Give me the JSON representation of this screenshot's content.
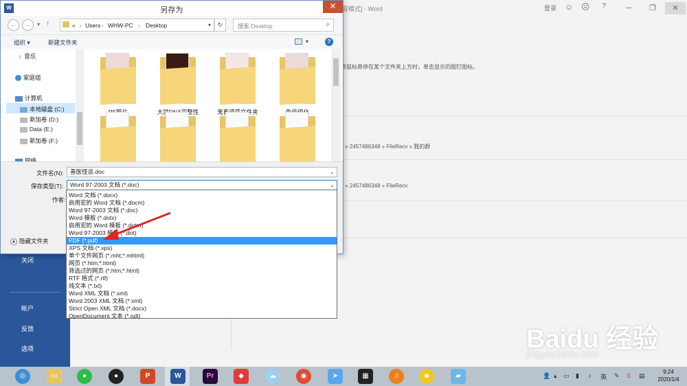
{
  "word": {
    "title_partial": "容模式] - Word",
    "login": "登录",
    "hint_text": "将鼠标悬停在某个文件夹上方时，单击显示的图钉图标。",
    "path1": "s » 2457486348 » FileRecv » 我的群",
    "path2": "s » 2457486348 » FileRecv",
    "nav": {
      "close": "关闭",
      "account": "帐户",
      "feedback": "反馈",
      "options": "选项"
    }
  },
  "dialog": {
    "title": "另存为",
    "app_icon": "W",
    "breadcrumb": [
      "«",
      "Users",
      "WHW-PC",
      "Desktop"
    ],
    "search_placeholder": "搜索 Desktop",
    "toolbar": {
      "organize": "组织 ▾",
      "new_folder": "新建文件夹"
    },
    "tree": [
      {
        "label": "音乐",
        "icon": "music-icon"
      },
      {
        "label": "家庭组",
        "icon": "homegroup-icon"
      },
      {
        "label": "计算机",
        "icon": "computer-icon"
      },
      {
        "label": "本地磁盘 (C:)",
        "icon": "drive-icon"
      },
      {
        "label": "新加卷 (D:)",
        "icon": "drive-icon"
      },
      {
        "label": "Data (E:)",
        "icon": "drive-icon"
      },
      {
        "label": "新加卷 (F:)",
        "icon": "drive-icon"
      },
      {
        "label": "网络",
        "icon": "network-icon"
      }
    ],
    "folders": [
      "PS照片",
      "大鼠DNA完整性",
      "鬼畜调音文件夹",
      "免疫组化",
      "",
      "",
      "",
      ""
    ],
    "filename_label": "文件名(N):",
    "filename_value": "善医怪谈.doc",
    "filetype_label": "保存类型(T):",
    "filetype_value": "Word 97-2003 文档 (*.doc)",
    "author_label": "作者:",
    "hide_folders": "隐藏文件夹",
    "filetype_options": [
      "Word 文档 (*.docx)",
      "启用宏的 Word 文档 (*.docm)",
      "Word 97-2003 文档 (*.doc)",
      "Word 模板 (*.dotx)",
      "启用宏的 Word 模板 (*.dotm)",
      "Word 97-2003 模板 (*.dot)",
      "PDF (*.pdf)",
      "XPS 文档 (*.xps)",
      "单个文件网页 (*.mht;*.mhtml)",
      "网页 (*.htm;*.html)",
      "筛选过的网页 (*.htm;*.html)",
      "RTF 格式 (*.rtf)",
      "纯文本 (*.txt)",
      "Word XML 文档 (*.xml)",
      "Word 2003 XML 文档 (*.xml)",
      "Strict Open XML 文档 (*.docx)",
      "OpenDocument 文本 (*.odt)"
    ],
    "selected_option_index": 6
  },
  "taskbar": {
    "apps": [
      "browser-icon",
      "explorer-icon",
      "wechat-icon",
      "qq-icon",
      "powerpoint-icon",
      "word-icon",
      "premiere-icon",
      "app-icon",
      "cloud-icon",
      "chrome-icon",
      "send-icon",
      "video-icon",
      "music-icon",
      "avatar-icon",
      "tablet-icon"
    ],
    "time": "9:24",
    "date": "2020/1/4",
    "ime": "英"
  },
  "watermark": {
    "main": "Baidu 经验",
    "sub": "jingyan.baidu.com"
  },
  "colors": {
    "accent": "#2b579a",
    "selection": "#3399ff",
    "close": "#c7502f",
    "arrow": "#d9262a"
  }
}
